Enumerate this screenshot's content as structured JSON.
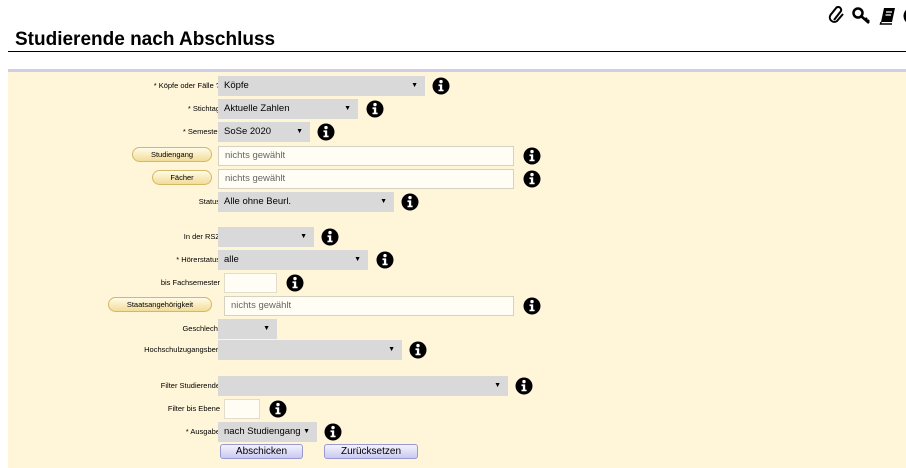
{
  "header": {
    "title": "Studierende nach Abschluss",
    "icons": [
      "paperclip-icon",
      "key-icon",
      "book-icon",
      "info-icon"
    ]
  },
  "form": {
    "koepfe": {
      "label": "* Köpfe oder Fälle ?",
      "value": "Köpfe"
    },
    "stichtag": {
      "label": "* Stichtag",
      "value": "Aktuelle Zahlen"
    },
    "semester": {
      "label": "* Semester",
      "value": "SoSe 2020"
    },
    "studiengang": {
      "button": "Studiengang",
      "value": "nichts gewählt"
    },
    "faecher": {
      "button": "Fächer",
      "value": "nichts gewählt"
    },
    "status": {
      "label": "Status",
      "value": "Alle ohne Beurl."
    },
    "rsz": {
      "label": "In der RSZ",
      "value": ""
    },
    "hoererstatus": {
      "label": "* Hörerstatus",
      "value": "alle"
    },
    "fachsemester": {
      "label": "bis Fachsemester",
      "value": ""
    },
    "staatsangehoerigkeit": {
      "button": "Staatsangehörigkeit",
      "value": "nichts gewählt"
    },
    "geschlecht": {
      "label": "Geschlecht",
      "value": ""
    },
    "hzb": {
      "label": "Hochschulzugangsber.",
      "value": ""
    },
    "filter_studierende": {
      "label": "Filter Studierende",
      "value": ""
    },
    "filter_ebene": {
      "label": "Filter bis Ebene",
      "value": ""
    },
    "ausgabe": {
      "label": "* Ausgabe",
      "value": "nach Studiengang"
    },
    "submit_label": "Abschicken",
    "reset_label": "Zurücksetzen",
    "dropdown_arrow": "▼"
  },
  "colors": {
    "panel_bg": "#fff5d8",
    "select_bg": "#d9d9d9",
    "panel_top_rule": "#cfcde8"
  }
}
